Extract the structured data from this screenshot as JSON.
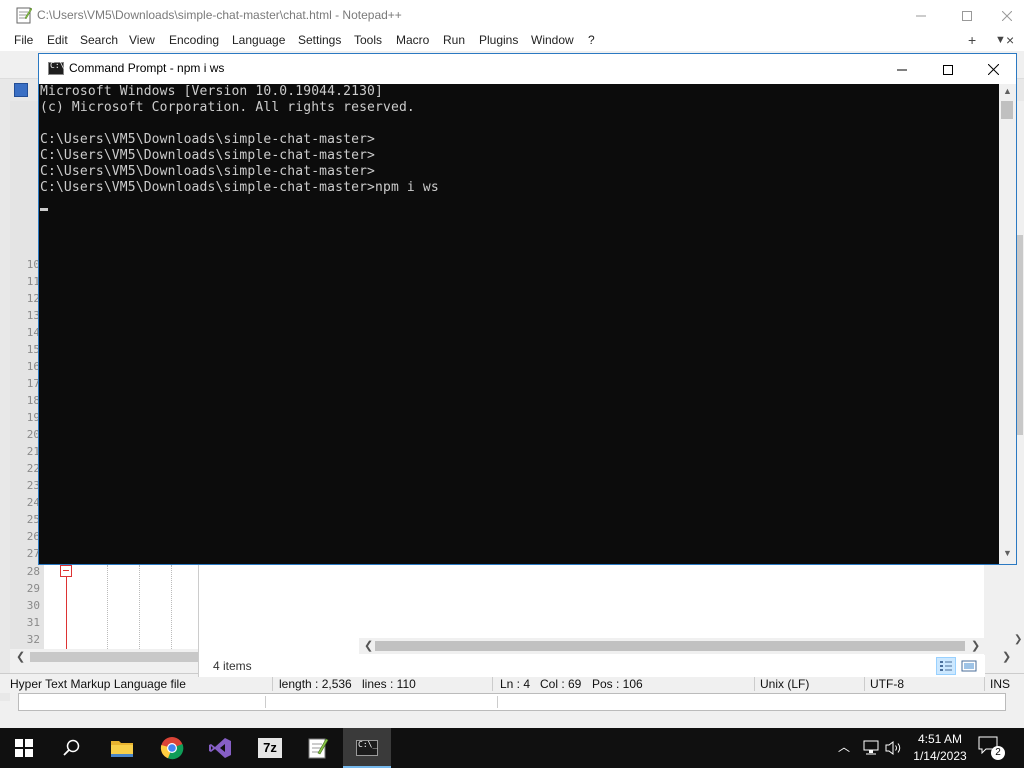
{
  "notepad": {
    "title": "C:\\Users\\VM5\\Downloads\\simple-chat-master\\chat.html - Notepad++",
    "menu": [
      "File",
      "Edit",
      "Search",
      "View",
      "Encoding",
      "Language",
      "Settings",
      "Tools",
      "Macro",
      "Run",
      "Plugins",
      "Window",
      "?"
    ],
    "menu_plus": "+",
    "menu_dropdown": "▼",
    "menu_close": "×",
    "line_numbers": [
      "10",
      "11",
      "12",
      "13",
      "14",
      "15",
      "16",
      "17",
      "18",
      "19",
      "20",
      "21",
      "22",
      "23",
      "24",
      "25",
      "26",
      "27",
      "28",
      "29",
      "30",
      "31",
      "32"
    ],
    "status": {
      "file_type": "Hyper Text Markup Language file",
      "length": "length : 2,536",
      "lines": "lines : 110",
      "ln": "Ln : 4",
      "col": "Col : 69",
      "pos": "Pos : 106",
      "eol": "Unix (LF)",
      "encoding": "UTF-8",
      "mode": "INS"
    }
  },
  "explorer": {
    "item_count": "4 items"
  },
  "cmd": {
    "title": "Command Prompt - npm  i ws",
    "lines": [
      "Microsoft Windows [Version 10.0.19044.2130]",
      "(c) Microsoft Corporation. All rights reserved.",
      "",
      "C:\\Users\\VM5\\Downloads\\simple-chat-master>",
      "C:\\Users\\VM5\\Downloads\\simple-chat-master>",
      "C:\\Users\\VM5\\Downloads\\simple-chat-master>",
      "C:\\Users\\VM5\\Downloads\\simple-chat-master>npm i ws"
    ]
  },
  "taskbar": {
    "apps": [
      "start-icon",
      "search-icon",
      "file-explorer-icon",
      "chrome-icon",
      "visual-studio-icon",
      "7zip-icon",
      "notepad-plus-plus-icon",
      "command-prompt-icon"
    ],
    "sevenzip_label": "7z",
    "cmd_icon_label": "C:\\_",
    "time": "4:51 AM",
    "date": "1/14/2023",
    "notification_count": "2"
  },
  "colors": {
    "console_bg": "#0c0c0c",
    "console_text": "#cccccc",
    "taskbar_bg": "#101010",
    "desktop_accent": "#0a74c9"
  }
}
